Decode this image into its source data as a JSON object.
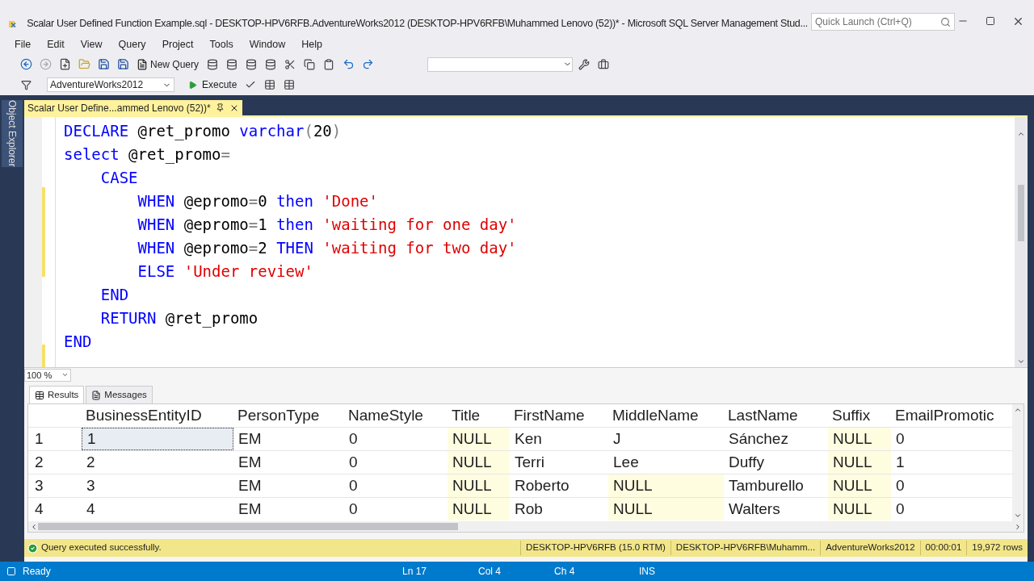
{
  "window": {
    "title": "Scalar User Defined Function Example.sql - DESKTOP-HPV6RFB.AdventureWorks2012 (DESKTOP-HPV6RFB\\Muhammed Lenovo (52))* - Microsoft SQL Server Management Stud...",
    "quick_launch": {
      "placeholder": "Quick Launch (Ctrl+Q)"
    }
  },
  "menu": [
    "File",
    "Edit",
    "View",
    "Query",
    "Project",
    "Tools",
    "Window",
    "Help"
  ],
  "toolbar": {
    "new_query": "New Query",
    "database": "AdventureWorks2012",
    "execute": "Execute"
  },
  "side_panel": "Object Explorer",
  "document_tab": {
    "title": "Scalar User Define...ammed Lenovo (52))*",
    "selected": true
  },
  "editor": {
    "lines": [
      {
        "changed": false,
        "tokens": [
          {
            "kind": "kw",
            "text": "DECLARE"
          },
          {
            "kind": "plain",
            "text": " @ret_promo "
          },
          {
            "kind": "kw",
            "text": "varchar"
          },
          {
            "kind": "gray",
            "text": "("
          },
          {
            "kind": "plain",
            "text": "20"
          },
          {
            "kind": "gray",
            "text": ")"
          }
        ]
      },
      {
        "changed": false,
        "tokens": [
          {
            "kind": "kw",
            "text": "select"
          },
          {
            "kind": "plain",
            "text": " @ret_promo"
          },
          {
            "kind": "gray",
            "text": "="
          }
        ]
      },
      {
        "changed": false,
        "tokens": [
          {
            "kind": "kw",
            "text": "    CASE"
          }
        ]
      },
      {
        "changed": true,
        "tokens": [
          {
            "kind": "kw",
            "text": "        WHEN"
          },
          {
            "kind": "plain",
            "text": " @epromo"
          },
          {
            "kind": "gray",
            "text": "="
          },
          {
            "kind": "plain",
            "text": "0 "
          },
          {
            "kind": "kw",
            "text": "then"
          },
          {
            "kind": "str",
            "text": " 'Done'"
          }
        ]
      },
      {
        "changed": true,
        "tokens": [
          {
            "kind": "kw",
            "text": "        WHEN"
          },
          {
            "kind": "plain",
            "text": " @epromo"
          },
          {
            "kind": "gray",
            "text": "="
          },
          {
            "kind": "plain",
            "text": "1 "
          },
          {
            "kind": "kw",
            "text": "then"
          },
          {
            "kind": "str",
            "text": " 'waiting for one day'"
          }
        ]
      },
      {
        "changed": true,
        "tokens": [
          {
            "kind": "kw",
            "text": "        WHEN"
          },
          {
            "kind": "plain",
            "text": " @epromo"
          },
          {
            "kind": "gray",
            "text": "="
          },
          {
            "kind": "plain",
            "text": "2 "
          },
          {
            "kind": "kw",
            "text": "THEN"
          },
          {
            "kind": "str",
            "text": " 'waiting for two day'"
          }
        ]
      },
      {
        "changed": true,
        "tokens": [
          {
            "kind": "kw",
            "text": "        ELSE"
          },
          {
            "kind": "str",
            "text": " 'Under review'"
          }
        ]
      },
      {
        "changed": false,
        "tokens": [
          {
            "kind": "kw",
            "text": "    END"
          }
        ]
      },
      {
        "changed": false,
        "tokens": [
          {
            "kind": "kw",
            "text": "    RETURN"
          },
          {
            "kind": "plain",
            "text": " @ret_promo"
          }
        ]
      },
      {
        "changed": false,
        "tokens": [
          {
            "kind": "kw",
            "text": "END"
          }
        ]
      },
      {
        "changed": true
      }
    ],
    "zoom": "100 %"
  },
  "result_tabs": [
    {
      "label": "Results",
      "selected": true
    },
    {
      "label": "Messages",
      "selected": false
    }
  ],
  "grid": {
    "columns": [
      "BusinessEntityID",
      "PersonType",
      "NameStyle",
      "Title",
      "FirstName",
      "MiddleName",
      "LastName",
      "Suffix",
      "EmailPromotic"
    ],
    "rows": [
      {
        "number": "1",
        "selected": true,
        "cells": [
          {
            "text": "1",
            "kind": "value"
          },
          {
            "text": "EM",
            "kind": "value"
          },
          {
            "text": "0",
            "kind": "value"
          },
          {
            "text": "NULL",
            "kind": "null"
          },
          {
            "text": "Ken",
            "kind": "value"
          },
          {
            "text": "J",
            "kind": "value"
          },
          {
            "text": "Sánchez",
            "kind": "value"
          },
          {
            "text": "NULL",
            "kind": "null"
          },
          {
            "text": "0",
            "kind": "value"
          }
        ]
      },
      {
        "number": "2",
        "selected": false,
        "cells": [
          {
            "text": "2",
            "kind": "value"
          },
          {
            "text": "EM",
            "kind": "value"
          },
          {
            "text": "0",
            "kind": "value"
          },
          {
            "text": "NULL",
            "kind": "null"
          },
          {
            "text": "Terri",
            "kind": "value"
          },
          {
            "text": "Lee",
            "kind": "value"
          },
          {
            "text": "Duffy",
            "kind": "value"
          },
          {
            "text": "NULL",
            "kind": "null"
          },
          {
            "text": "1",
            "kind": "value"
          }
        ]
      },
      {
        "number": "3",
        "selected": false,
        "cells": [
          {
            "text": "3",
            "kind": "value"
          },
          {
            "text": "EM",
            "kind": "value"
          },
          {
            "text": "0",
            "kind": "value"
          },
          {
            "text": "NULL",
            "kind": "null"
          },
          {
            "text": "Roberto",
            "kind": "value"
          },
          {
            "text": "NULL",
            "kind": "null"
          },
          {
            "text": "Tamburello",
            "kind": "value"
          },
          {
            "text": "NULL",
            "kind": "null"
          },
          {
            "text": "0",
            "kind": "value"
          }
        ]
      },
      {
        "number": "4",
        "selected": false,
        "cells": [
          {
            "text": "4",
            "kind": "value"
          },
          {
            "text": "EM",
            "kind": "value"
          },
          {
            "text": "0",
            "kind": "value"
          },
          {
            "text": "NULL",
            "kind": "null"
          },
          {
            "text": "Rob",
            "kind": "value"
          },
          {
            "text": "NULL",
            "kind": "null"
          },
          {
            "text": "Walters",
            "kind": "value"
          },
          {
            "text": "NULL",
            "kind": "null"
          },
          {
            "text": "0",
            "kind": "value"
          }
        ]
      }
    ]
  },
  "query_status": {
    "message": "Query executed successfully.",
    "server": "DESKTOP-HPV6RFB (15.0 RTM)",
    "user": "DESKTOP-HPV6RFB\\Muhamm...",
    "database": "AdventureWorks2012",
    "elapsed": "00:00:01",
    "rows": "19,972 rows"
  },
  "status_bar": {
    "state": "Ready",
    "line": "Ln 17",
    "column": "Col 4",
    "char": "Ch 4",
    "mode": "INS"
  }
}
